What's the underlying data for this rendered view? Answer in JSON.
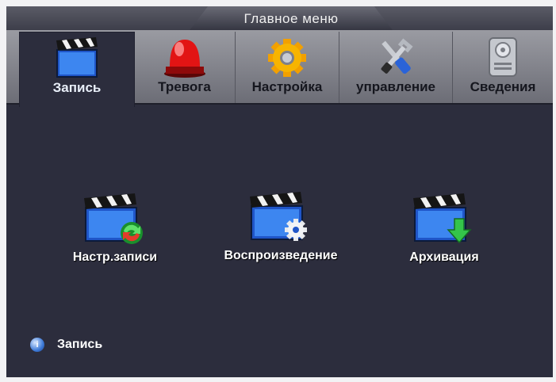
{
  "header": {
    "title": "Главное меню"
  },
  "tabs": [
    {
      "label": "Запись",
      "icon": "clapperboard-icon",
      "active": true
    },
    {
      "label": "Тревога",
      "icon": "alarm-siren-icon",
      "active": false
    },
    {
      "label": "Настройка",
      "icon": "gear-icon",
      "active": false
    },
    {
      "label": "управление",
      "icon": "tools-icon",
      "active": false
    },
    {
      "label": "Сведения",
      "icon": "hard-drive-icon",
      "active": false
    }
  ],
  "menu": [
    {
      "label": "Настр.записи",
      "icon": "record-settings-icon"
    },
    {
      "label": "Воспроизведение",
      "icon": "playback-icon"
    },
    {
      "label": "Архивация",
      "icon": "backup-icon"
    }
  ],
  "status": {
    "text": "Запись",
    "icon": "info-icon"
  },
  "colors": {
    "background": "#2c2d3d",
    "accent": "#2f6fe0",
    "tab_bar": "#8a8b93"
  }
}
